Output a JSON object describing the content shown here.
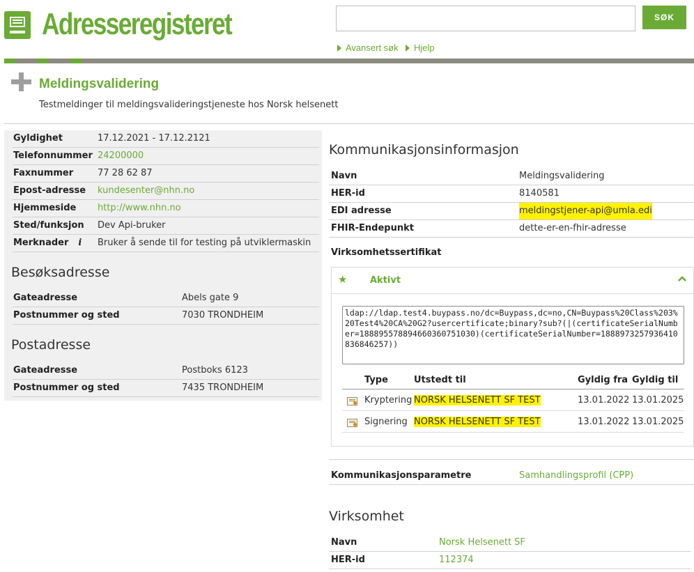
{
  "header": {
    "app_title": "Adresseregisteret",
    "search_placeholder": "",
    "search_button": "SØK",
    "links": [
      "Avansert søk",
      "Hjelp"
    ]
  },
  "page": {
    "title": "Meldingsvalidering",
    "subtitle": "Testmeldinger til meldingsvalideringstjeneste hos Norsk helsenett"
  },
  "details": [
    {
      "label": "Gyldighet",
      "value": "17.12.2021 - 17.12.2121",
      "link": false
    },
    {
      "label": "Telefonnummer",
      "value": "24200000",
      "link": true
    },
    {
      "label": "Faxnummer",
      "value": "77 28 62 87",
      "link": false
    },
    {
      "label": "Epost-adresse",
      "value": "kundesenter@nhn.no",
      "link": true
    },
    {
      "label": "Hjemmeside",
      "value": "http://www.nhn.no",
      "link": true
    },
    {
      "label": "Sted/funksjon",
      "value": "Dev Api-bruker",
      "link": false
    },
    {
      "label": "Merknader",
      "value": "Bruker å sende til for testing på utviklermaskin",
      "link": false
    }
  ],
  "visit_address": {
    "heading": "Besøksadresse",
    "rows": [
      {
        "label": "Gateadresse",
        "value": "Abels gate 9"
      },
      {
        "label": "Postnummer og sted",
        "value": "7030 TRONDHEIM"
      }
    ]
  },
  "postal_address": {
    "heading": "Postadresse",
    "rows": [
      {
        "label": "Gateadresse",
        "value": "Postboks 6123"
      },
      {
        "label": "Postnummer og sted",
        "value": "7435 TRONDHEIM"
      }
    ]
  },
  "communication": {
    "heading": "Kommunikasjonsinformasjon",
    "rows": [
      {
        "label": "Navn",
        "value": "Meldingsvalidering"
      },
      {
        "label": "HER-id",
        "value": "8140581"
      },
      {
        "label": "EDI adresse",
        "value": "meldingstjener-api@umla.edi"
      },
      {
        "label": "FHIR-Endepunkt",
        "value": "dette-er-en-fhir-adresse"
      }
    ]
  },
  "certificate": {
    "heading": "Virksomhetssertifikat",
    "status": "Aktivt",
    "ldap": "ldap://ldap.test4.buypass.no/dc=Buypass,dc=no,CN=Buypass%20Class%203%20Test4%20CA%20G2?usercertificate;binary?sub?(|(certificateSerialNumber=1888955788946603607510​30)(certificateSerialNumber=188897325793641083​6846257))",
    "columns": [
      "Type",
      "Utstedt til",
      "Gyldig fra",
      "Gyldig til"
    ],
    "rows": [
      {
        "type": "Kryptering",
        "issued_to": "NORSK HELSENETT SF TEST",
        "valid_from": "13.01.2022",
        "valid_to": "13.01.2025"
      },
      {
        "type": "Signering",
        "issued_to": "NORSK HELSENETT SF TEST",
        "valid_from": "13.01.2022",
        "valid_to": "13.01.2025"
      }
    ]
  },
  "comm_params": {
    "label": "Kommunikasjonsparametre",
    "value": "Samhandlingsprofil (CPP)"
  },
  "organization": {
    "heading": "Virksomhet",
    "rows": [
      {
        "label": "Navn",
        "value": "Norsk Helsenett SF"
      },
      {
        "label": "HER-id",
        "value": "112374"
      }
    ]
  },
  "colors": {
    "accent": "#6aab35",
    "header_rule": "#8d8b80",
    "highlight": "#fff200"
  }
}
